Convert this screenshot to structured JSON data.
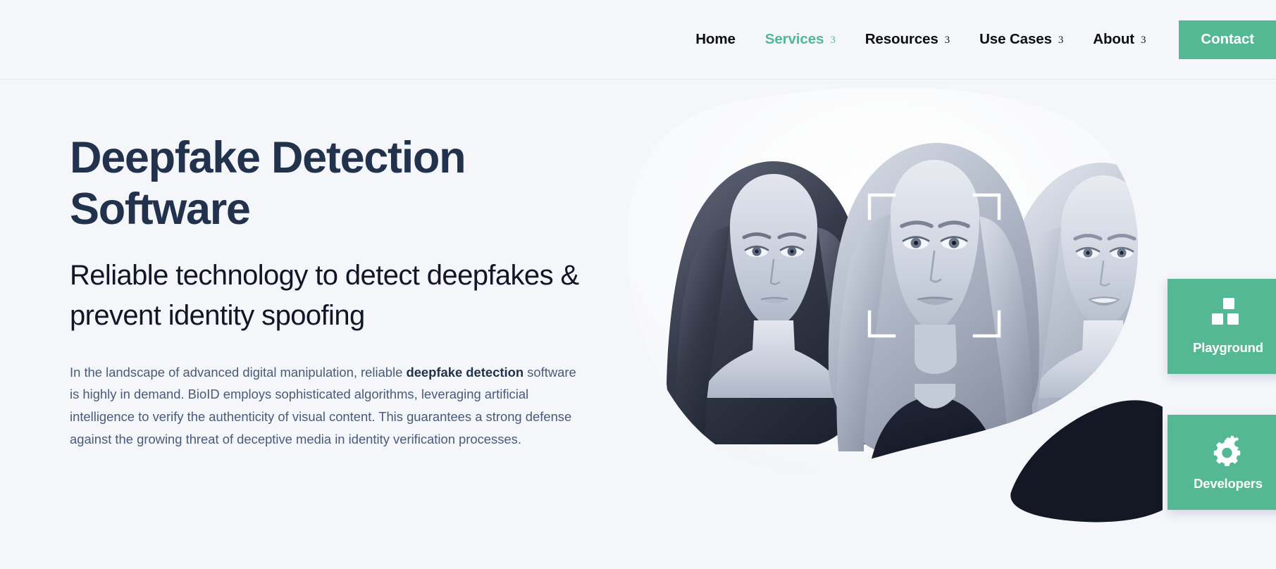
{
  "header": {
    "nav_items": [
      {
        "label": "Home",
        "has_caret": false,
        "active": false
      },
      {
        "label": "Services",
        "has_caret": true,
        "active": true
      },
      {
        "label": "Resources",
        "has_caret": true,
        "active": false
      },
      {
        "label": "Use Cases",
        "has_caret": true,
        "active": false
      },
      {
        "label": "About",
        "has_caret": true,
        "active": false
      }
    ],
    "caret_glyph": "3",
    "cta_label": "Contact",
    "active_color": "#4fb996",
    "cta_bg": "#55b894",
    "cta_text_color": "#ffffff",
    "text_color": "#0d0d14",
    "background": "#f4f6fa",
    "border_color": "#e5e8ef"
  },
  "hero": {
    "title": "Deepfake Detection Software",
    "subtitle": "Reliable technology to detect deepfakes & prevent identity spoofing",
    "body_before_bold": "In the landscape of advanced digital manipulation, reliable ",
    "body_bold": "deepfake detection",
    "body_after_bold": " software is highly in demand. BioID employs sophisticated algorithms, leveraging artificial intelligence to verify the authenticity of visual content. This guarantees a strong defense against the growing threat of deceptive media in identity verification processes.",
    "title_color": "#22324d",
    "subtitle_color": "#111726",
    "body_color": "#4a5b78",
    "background": "#f4f6fa",
    "image_alt": "Three women portraits in greyscale inside an organic blob shape, the centre face framed by white face-detection corner brackets"
  },
  "side_tabs": [
    {
      "label": "Playground",
      "icon": "blocks-icon"
    },
    {
      "label": "Developers",
      "icon": "gears-icon"
    }
  ],
  "colors": {
    "brand_green": "#55b894",
    "page_background": "#f4f6fa",
    "navy": "#22324d",
    "blob_dark": "#141824"
  }
}
